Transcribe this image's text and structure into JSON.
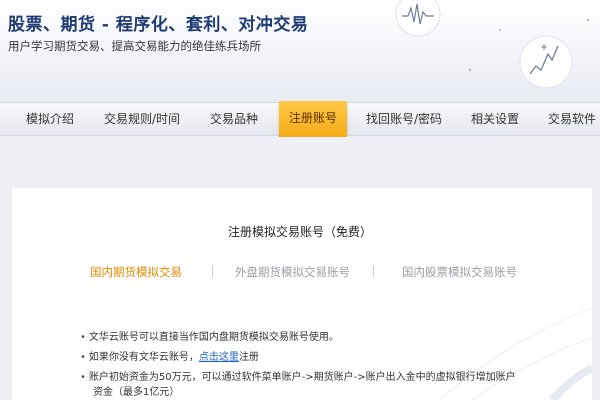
{
  "banner": {
    "title": "股票、期货 - 程序化、套利、对冲交易",
    "subtitle": "用户学习期货交易、提高交易能力的绝佳练兵场所",
    "accent_color": "#1f3b73"
  },
  "nav": {
    "items": [
      {
        "label": "模拟介绍"
      },
      {
        "label": "交易规则/时间"
      },
      {
        "label": "交易品种"
      },
      {
        "label": "注册账号",
        "active": true
      },
      {
        "label": "找回账号/密码"
      },
      {
        "label": "相关设置"
      },
      {
        "label": "交易软件"
      }
    ],
    "active_color": "#f4a914"
  },
  "register": {
    "title": "注册模拟交易账号（免费）",
    "tabs": [
      {
        "label": "国内期货模拟交易",
        "active": true
      },
      {
        "label": "外盘期货模拟交易账号"
      },
      {
        "label": "国内股票模拟交易账号"
      }
    ],
    "notes": {
      "line1": "文华云账号可以直接当作国内盘期货模拟交易账号使用。",
      "line2_prefix": "如果你没有文华云账号，",
      "line2_link": "点击这里",
      "line2_suffix": "注册",
      "line3": "账户初始资金为50万元，可以通过软件菜单账户->期货账户->账户出入金中的虚拟银行增加账户",
      "line3_cont": "资金（最多1亿元）"
    }
  }
}
